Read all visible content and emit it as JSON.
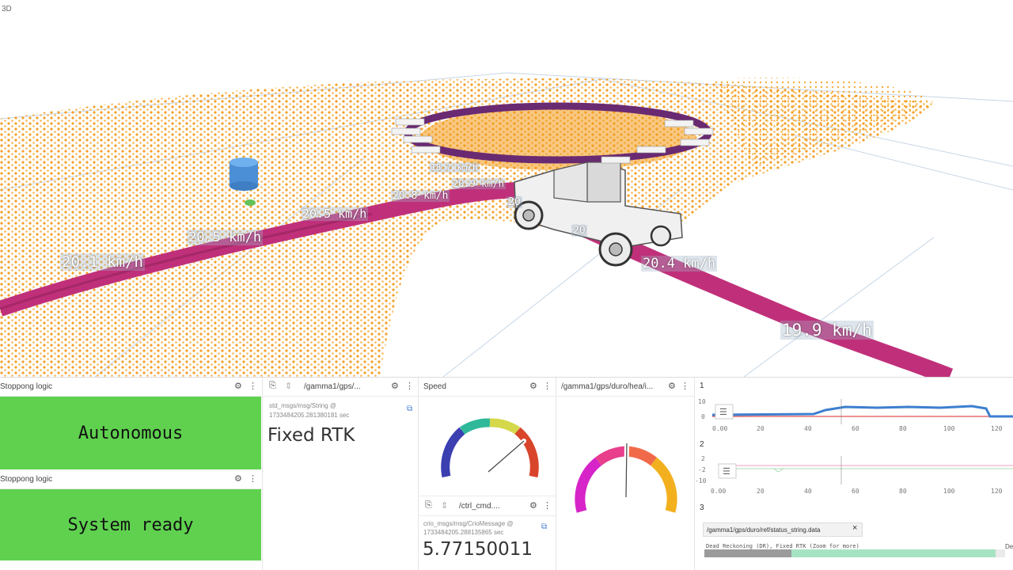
{
  "viewport": {
    "label": "3D",
    "speed_labels": [
      "20.1 km/h",
      "20.5 km/h",
      "20.5 km/h",
      "20.8 km/h",
      "20.9 km/h",
      "18.7 km/h",
      "20.4 km/h",
      "19.9 km/h",
      "20",
      "20"
    ]
  },
  "panels": {
    "stop1": {
      "title": "Stoppong logic",
      "status": "Autonomous",
      "color": "#5fd14f"
    },
    "stop2": {
      "title": "Stoppong logic",
      "status": "System ready",
      "color": "#5fd14f"
    },
    "gps": {
      "title": "/gamma1/gps/...",
      "msg_type": "std_msgs/msg/String @",
      "timestamp": "1733484205.281380181 sec",
      "value": "Fixed RTK"
    },
    "speed": {
      "title": "Speed"
    },
    "ctrl": {
      "title": "/ctrl_cmd....",
      "msg_type": "crio_msgs/msg/CrioMessage @",
      "timestamp": "1733484205.288135865 sec",
      "value": "5.77150011"
    },
    "heading": {
      "title": "/gamma1/gps/duro/hea/i..."
    },
    "plots": {
      "plot1": {
        "index": "1",
        "y_ticks": [
          "10",
          "0"
        ],
        "x_ticks": [
          "0.00",
          "20",
          "40",
          "60",
          "80",
          "100",
          "120"
        ]
      },
      "plot2": {
        "index": "2",
        "y_ticks": [
          "2",
          "-2",
          "-10"
        ],
        "x_ticks": [
          "0.00",
          "20",
          "40",
          "60",
          "80",
          "100",
          "120"
        ]
      },
      "plot3": {
        "index": "3",
        "tab_label": "/gamma1/gps/duro/ref/status_string.data",
        "state_text": "Dead Reckoning (DR), Fixed RTK (Zoom for more)",
        "edge_text": "De"
      }
    }
  },
  "colors": {
    "status_green": "#5fd14f",
    "path_magenta": "#c0307a",
    "points_orange": "#f39a1c",
    "plot_blue": "#3d7fcf",
    "plot_red": "#e05050"
  }
}
